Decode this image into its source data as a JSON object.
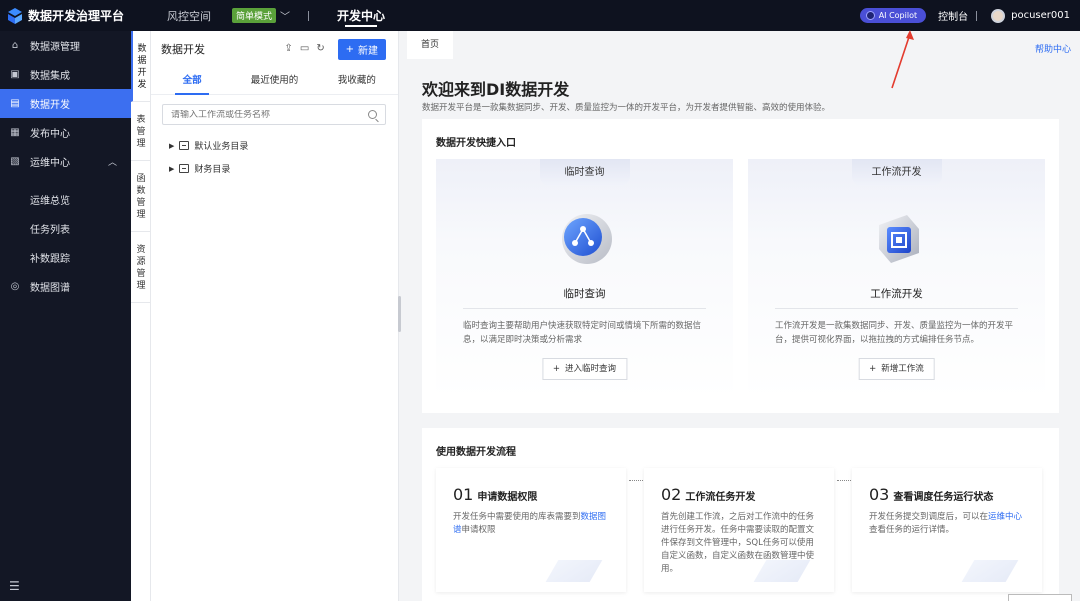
{
  "topbar": {
    "brand": "数据开发治理平台",
    "nav_risk": "风控空间",
    "mode_badge": "简单模式",
    "nav_active": "开发中心",
    "copilot_label": "AI Copilot",
    "console": "控制台",
    "username": "pocuser001"
  },
  "sidebar": {
    "items": [
      {
        "label": "数据源管理",
        "icon": "home-icon"
      },
      {
        "label": "数据集成",
        "icon": "integration-icon"
      },
      {
        "label": "数据开发",
        "icon": "develop-icon",
        "active": true
      },
      {
        "label": "发布中心",
        "icon": "publish-icon"
      },
      {
        "label": "运维中心",
        "icon": "ops-icon"
      }
    ],
    "sub_items": [
      "运维总览",
      "任务列表",
      "补数跟踪"
    ],
    "extra_item": {
      "label": "数据图谱",
      "icon": "graph-icon"
    }
  },
  "vtabs": [
    "数据开发",
    "表管理",
    "函数管理",
    "资源管理"
  ],
  "explorer": {
    "title": "数据开发",
    "new_button": "新建",
    "tabs": [
      "全部",
      "最近使用的",
      "我收藏的"
    ],
    "search_placeholder": "请输入工作流或任务名称",
    "tree": [
      "默认业务目录",
      "财务目录"
    ]
  },
  "main": {
    "tab": "首页",
    "help": "帮助中心",
    "welcome_title": "欢迎来到DI数据开发",
    "welcome_sub": "数据开发平台是一款集数据同步、开发、质量监控为一体的开发平台，为开发者提供智能、高效的使用体验。",
    "quick_title": "数据开发快捷入口",
    "entries": [
      {
        "tag": "临时查询",
        "name": "临时查询",
        "desc": "临时查询主要帮助用户快速获取特定时间或情境下所需的数据信息，以满足即时决策或分析需求",
        "button": "进入临时查询"
      },
      {
        "tag": "工作流开发",
        "name": "工作流开发",
        "desc": "工作流开发是一款集数据同步、开发、质量监控为一体的开发平台，提供可视化界面，以拖拉拽的方式编排任务节点。",
        "button": "新增工作流"
      }
    ],
    "flow_title": "使用数据开发流程",
    "steps": [
      {
        "num": "01",
        "title": "申请数据权限",
        "desc_pre": "开发任务中需要使用的库表需要到",
        "link": "数据图谱",
        "desc_post": "申请权限"
      },
      {
        "num": "02",
        "title": "工作流任务开发",
        "desc_pre": "首先创建工作流，之后对工作流中的任务进行任务开发。任务中需要读取的配置文件保存到文件管理中，SQL任务可以使用自定义函数，自定义函数在函数管理中使用。",
        "link": "",
        "desc_post": ""
      },
      {
        "num": "03",
        "title": "查看调度任务运行状态",
        "desc_pre": "开发任务提交到调度后，可以在",
        "link": "运维中心",
        "desc_post": "查看任务的运行详情。"
      }
    ]
  },
  "colors": {
    "accent": "#2d6cf2",
    "sidebar_bg": "#131725",
    "topbar_bg": "#0e121f",
    "copilot": "#4a4fd6",
    "badge": "#5aa13a"
  }
}
